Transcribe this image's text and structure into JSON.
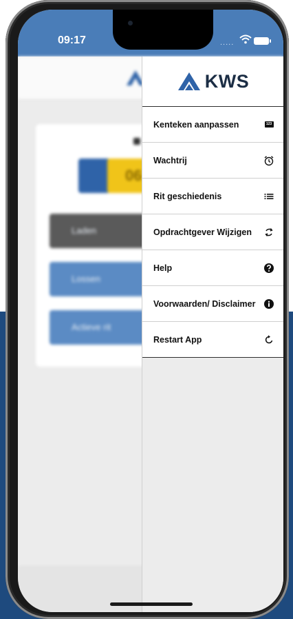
{
  "status_bar": {
    "time": "09:17",
    "signal": "....."
  },
  "brand": {
    "name": "KWS",
    "color": "#2f63a8",
    "text_color": "#1c2e45"
  },
  "background_app": {
    "code_visible": "06",
    "buttons": [
      "Laden",
      "Lossen",
      "Actieve rit"
    ]
  },
  "drawer": {
    "items": [
      {
        "label": "Kenteken aanpassen",
        "icon": "license-plate-icon",
        "plate_text": "123"
      },
      {
        "label": "Wachtrij",
        "icon": "alarm-clock-icon"
      },
      {
        "label": "Rit geschiedenis",
        "icon": "list-icon"
      },
      {
        "label": "Opdrachtgever Wijzigen",
        "icon": "swap-refresh-icon"
      },
      {
        "label": "Help",
        "icon": "question-circle-icon"
      },
      {
        "label": "Voorwaarden/ Disclaimer",
        "icon": "info-circle-icon"
      },
      {
        "label": "Restart App",
        "icon": "restart-icon"
      }
    ]
  },
  "colors": {
    "status_bar": "#4a7db8",
    "page_band": "#1e4a7e",
    "button_blue": "#5b8bc4",
    "button_dark": "#5a5a5a",
    "code_yellow": "#f0c419"
  }
}
